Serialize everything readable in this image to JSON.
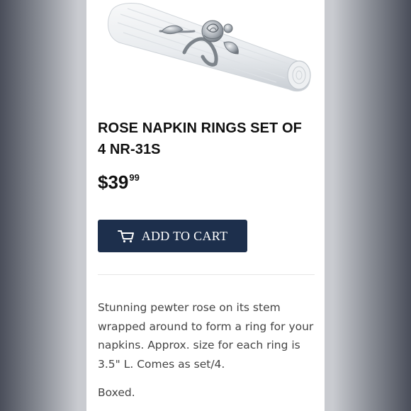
{
  "product": {
    "title": "ROSE NAPKIN RINGS SET OF 4 NR-31S",
    "price_main": "$39",
    "price_cents": "99",
    "add_to_cart_label": "ADD TO CART",
    "description": " Stunning pewter rose on its stem wrapped around to form a ring for your napkins. Approx. size for each ring is 3.5\" L. Comes as set/4.",
    "boxed_note": "Boxed."
  },
  "icons": {
    "cart": "cart-icon"
  },
  "colors": {
    "button_bg": "#1d2f4c",
    "button_text": "#ffffff",
    "title_text": "#111111",
    "body_text": "#444444",
    "page_bg": "#ffffff"
  }
}
